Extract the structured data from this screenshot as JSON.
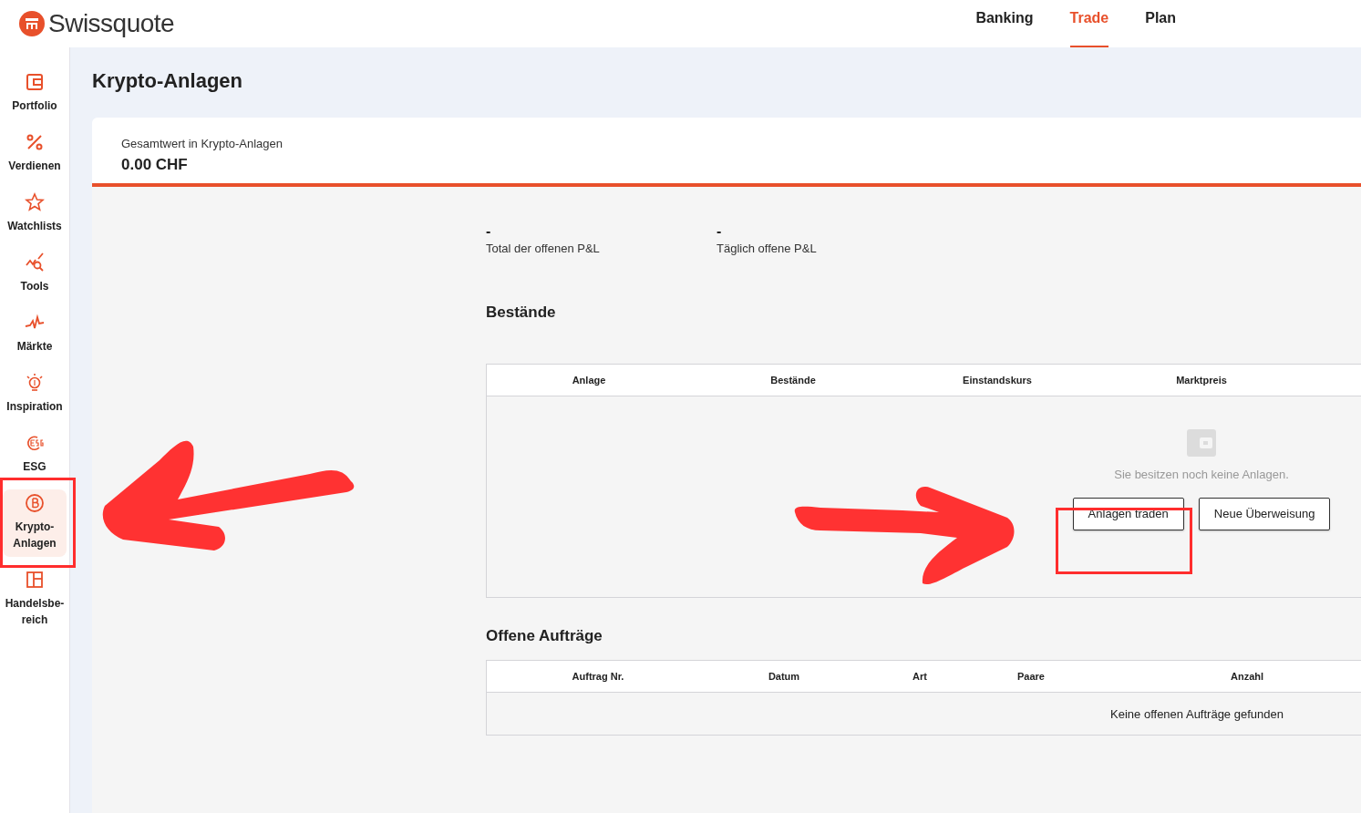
{
  "brand": "Swissquote",
  "top_nav": [
    {
      "label": "Banking",
      "selected": false
    },
    {
      "label": "Trade",
      "selected": true
    },
    {
      "label": "Plan",
      "selected": false
    }
  ],
  "sidebar": [
    {
      "label": "Portfolio",
      "kind": "wallet",
      "selected": false
    },
    {
      "label": "Verdienen",
      "kind": "percent",
      "selected": false
    },
    {
      "label": "Watchlists",
      "kind": "star",
      "selected": false
    },
    {
      "label": "Tools",
      "kind": "tools",
      "selected": false
    },
    {
      "label": "Märkte",
      "kind": "pulse",
      "selected": false
    },
    {
      "label": "Inspiration",
      "kind": "bulb",
      "selected": false
    },
    {
      "label": "ESG",
      "kind": "esg",
      "selected": false
    },
    {
      "label": "Krypto-Anlagen",
      "kind": "coin",
      "selected": true
    },
    {
      "label": "Handelsbe-reich",
      "kind": "layout",
      "selected": false
    }
  ],
  "page_title": "Krypto-Anlagen",
  "summary": {
    "label": "Gesamtwert in Krypto-Anlagen",
    "value": "0.00 CHF"
  },
  "stats": [
    {
      "value": "-",
      "label": "Total der offenen P&L"
    },
    {
      "value": "-",
      "label": "Täglich offene P&L"
    }
  ],
  "holdings": {
    "heading": "Bestände",
    "columns": [
      "Anlage",
      "Bestände",
      "Einstandskurs",
      "Marktpreis"
    ],
    "empty_message": "Sie besitzen noch keine Anlagen.",
    "buttons": [
      "Anlagen traden",
      "Neue Überweisung"
    ]
  },
  "orders": {
    "heading": "Offene Aufträge",
    "columns": [
      "Auftrag Nr.",
      "Datum",
      "Art",
      "Paare",
      "Anzahl"
    ],
    "empty_message": "Keine offenen Aufträge gefunden"
  }
}
